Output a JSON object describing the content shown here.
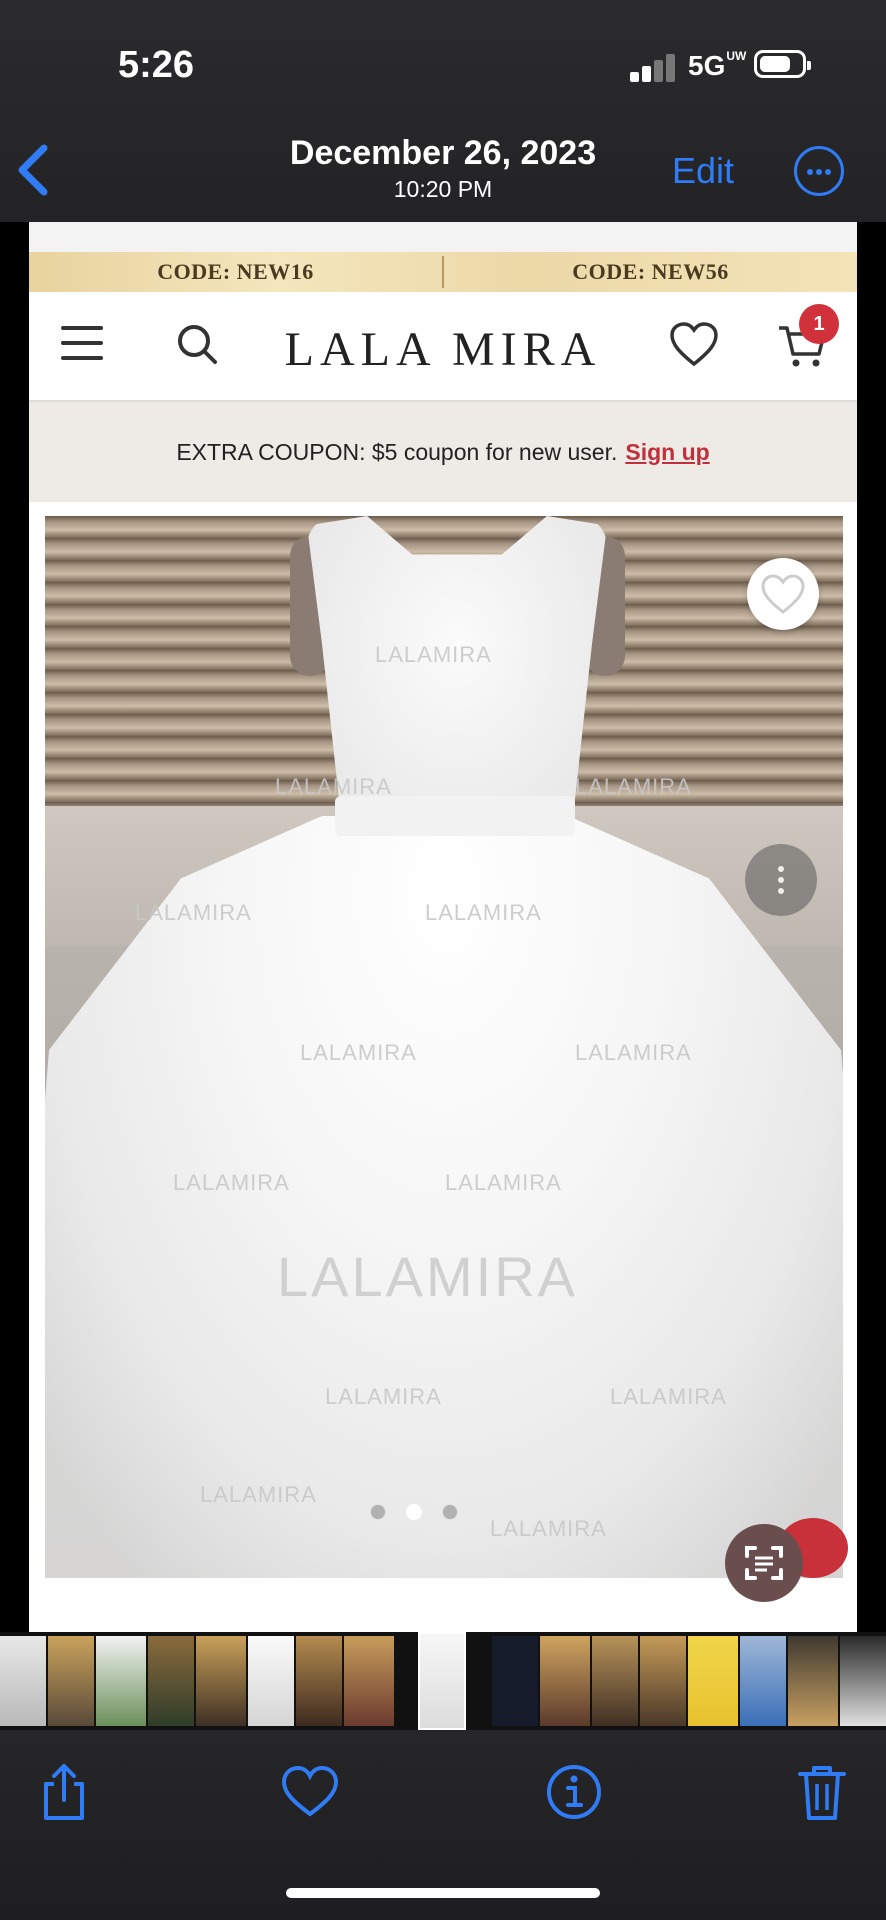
{
  "status": {
    "time": "5:26",
    "network": "5G",
    "network_sup": "UW"
  },
  "nav": {
    "title": "December 26, 2023",
    "subtitle": "10:20 PM",
    "edit": "Edit"
  },
  "site": {
    "promo_left": "CODE: NEW16",
    "promo_right": "CODE: NEW56",
    "logo": "LALA MIRA",
    "cart_count": "1",
    "coupon_text": "EXTRA COUPON: $5 coupon for new user.",
    "coupon_link": "Sign up",
    "watermark": "LALAMIRA",
    "watermark_small": "LALAMIRA"
  },
  "icons": {
    "back": "chevron-left-icon",
    "more": "ellipsis-circle-icon",
    "share": "share-icon",
    "favorite": "heart-icon",
    "info": "info-icon",
    "delete": "trash-icon"
  },
  "colors": {
    "accent": "#2f7cf6",
    "badge": "#d1313b",
    "sign_up": "#c0303a"
  }
}
